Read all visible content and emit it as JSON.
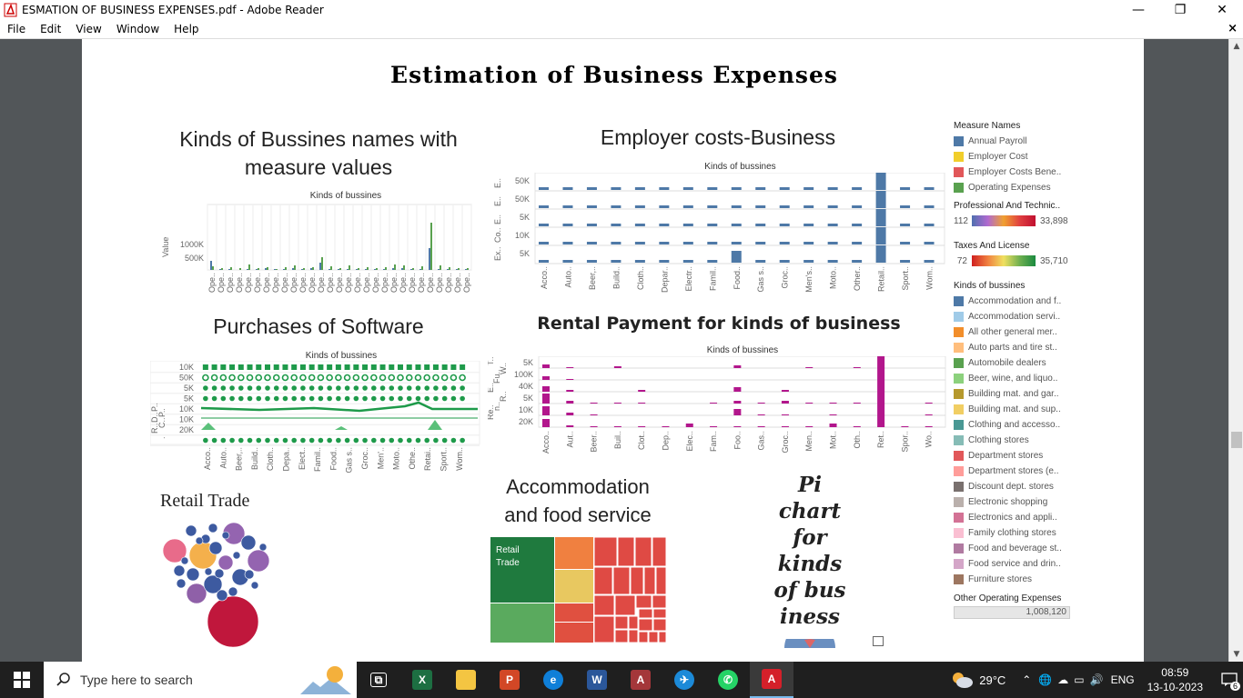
{
  "window": {
    "title": "ESMATION OF BUSINESS EXPENSES.pdf - Adobe Reader",
    "controls": [
      "minimize-icon",
      "restore-icon",
      "close-icon"
    ]
  },
  "menu": {
    "items": [
      "File",
      "Edit",
      "View",
      "Window",
      "Help"
    ],
    "close_glyph": "×"
  },
  "dashboard": {
    "title": "Estimation of Business Expenses",
    "sheet1": {
      "title_line1": "Kinds of Bussines names with",
      "title_line2": "measure values",
      "header": "Kinds of bussines",
      "yaxis": "Value",
      "ticks": [
        "1000K",
        "500K"
      ],
      "xlabel": "Ope.."
    },
    "sheet2": {
      "title": "Employer costs-Business",
      "header": "Kinds of bussines",
      "row_labels": [
        "E..",
        "E..",
        "E..",
        "Co..",
        "Ex.."
      ],
      "row_ticks": [
        "50K",
        "50K",
        "5K",
        "10K",
        "5K"
      ],
      "categories": [
        "Acco..",
        "Auto..",
        "Beer,..",
        "Build..",
        "Cloth..",
        "Depar..",
        "Electr..",
        "Famil..",
        "Food..",
        "Gas s..",
        "Groc..",
        "Men's..",
        "Moto..",
        "Other..",
        "Retail..",
        "Sport..",
        "Wom.."
      ]
    },
    "sheet3": {
      "title": "Purchases of Software",
      "header": "Kinds of bussines",
      "row_labels": [
        "P..",
        "P..",
        "D..",
        "C..",
        "R..",
        "."
      ],
      "row_ticks": [
        "10K",
        "50K",
        "5K",
        "5K",
        "10K",
        "10K",
        "20K"
      ],
      "categories": [
        "Acco..",
        "Auto..",
        "Beer,..",
        "Build..",
        "Cloth..",
        "Depa..",
        "Elect..",
        "Famil..",
        "Food..",
        "Gas s..",
        "Groc..",
        "Men'..",
        "Moto..",
        "Othe..",
        "Retai..",
        "Sport..",
        "Wom.."
      ]
    },
    "sheet4": {
      "title": "Rental Payment for kinds of business",
      "header": "Kinds of bussines",
      "row_labels": [
        "Re..",
        "n..",
        "R..",
        "E..",
        "Fu..",
        "W..",
        "T.."
      ],
      "row_ticks": [
        "5K",
        "100K",
        "40K",
        "5K",
        "10K",
        "20K"
      ],
      "categories": [
        "Acco..",
        "Aut..",
        "Beer..",
        "Buil..",
        "Clot..",
        "Dep..",
        "Elec..",
        "Fam..",
        "Foo..",
        "Gas..",
        "Groc..",
        "Men..",
        "Mot..",
        "Oth..",
        "Ret..",
        "Spor..",
        "Wo.."
      ]
    },
    "sheet5": {
      "title": "Retail Trade"
    },
    "sheet6": {
      "title_line1": "Accommodation",
      "title_line2": "and food service",
      "tile_label_line1": "Retail",
      "tile_label_line2": "Trade"
    },
    "sheet7": {
      "title_lines": [
        "Pi",
        "chart",
        "for",
        "kinds",
        "of bus",
        "iness"
      ]
    }
  },
  "legend": {
    "measure_names_title": "Measure Names",
    "measure_names": [
      {
        "label": "Annual Payroll",
        "color": "#4e79a7"
      },
      {
        "label": "Employer Cost",
        "color": "#f1ce2b"
      },
      {
        "label": "Employer Costs Bene..",
        "color": "#e15759"
      },
      {
        "label": "Operating Expenses",
        "color": "#59a14f"
      }
    ],
    "prof_title": "Professional And Technic..",
    "prof_min": "112",
    "prof_max": "33,898",
    "tax_title": "Taxes And License",
    "tax_min": "72",
    "tax_max": "35,710",
    "kinds_title": "Kinds of bussines",
    "kinds": [
      {
        "label": "Accommodation and f..",
        "color": "#4e79a7"
      },
      {
        "label": "Accommodation servi..",
        "color": "#a0cbe8"
      },
      {
        "label": "All other general mer..",
        "color": "#f28e2b"
      },
      {
        "label": "Auto parts and tire st..",
        "color": "#ffbe7d"
      },
      {
        "label": "Automobile dealers",
        "color": "#59a14f"
      },
      {
        "label": "Beer, wine, and liquo..",
        "color": "#8cd17d"
      },
      {
        "label": "Building mat. and gar..",
        "color": "#b6992d"
      },
      {
        "label": "Building mat. and sup..",
        "color": "#f1ce63"
      },
      {
        "label": "Clothing and accesso..",
        "color": "#499894"
      },
      {
        "label": "Clothing stores",
        "color": "#86bcb6"
      },
      {
        "label": "Department stores",
        "color": "#e15759"
      },
      {
        "label": "Department stores (e..",
        "color": "#ff9d9a"
      },
      {
        "label": "Discount dept. stores",
        "color": "#79706e"
      },
      {
        "label": "Electronic shopping",
        "color": "#bab0ac"
      },
      {
        "label": "Electronics and appli..",
        "color": "#d37295"
      },
      {
        "label": "Family clothing stores",
        "color": "#fabfd2"
      },
      {
        "label": "Food and beverage st..",
        "color": "#b07aa1"
      },
      {
        "label": "Food service and drin..",
        "color": "#d4a6c8"
      },
      {
        "label": "Furniture stores",
        "color": "#9d7660"
      }
    ],
    "oop_title": "Other Operating Expenses",
    "oop_value": "1,008,120"
  },
  "taskbar": {
    "search_placeholder": "Type here to search",
    "apps": [
      {
        "name": "task-view-icon",
        "glyph": "⧉",
        "color": "#1f1f1f"
      },
      {
        "name": "excel-icon",
        "glyph": "X",
        "color": "#1d6f42"
      },
      {
        "name": "file-explorer-icon",
        "glyph": "",
        "color": "#f4c542"
      },
      {
        "name": "powerpoint-icon",
        "glyph": "P",
        "color": "#d24726"
      },
      {
        "name": "edge-icon",
        "glyph": "e",
        "color": "#0f7fd8"
      },
      {
        "name": "word-icon",
        "glyph": "W",
        "color": "#2b579a"
      },
      {
        "name": "access-icon",
        "glyph": "A",
        "color": "#a4373a"
      },
      {
        "name": "flight-app-icon",
        "glyph": "✈",
        "color": "#1c8ad8"
      },
      {
        "name": "whatsapp-icon",
        "glyph": "✆",
        "color": "#25d366"
      },
      {
        "name": "adobe-reader-icon",
        "glyph": "A",
        "color": "#d4202a"
      }
    ],
    "temperature": "29°C",
    "language": "ENG",
    "time": "08:59",
    "date": "13-10-2023",
    "notifications": "6"
  }
}
